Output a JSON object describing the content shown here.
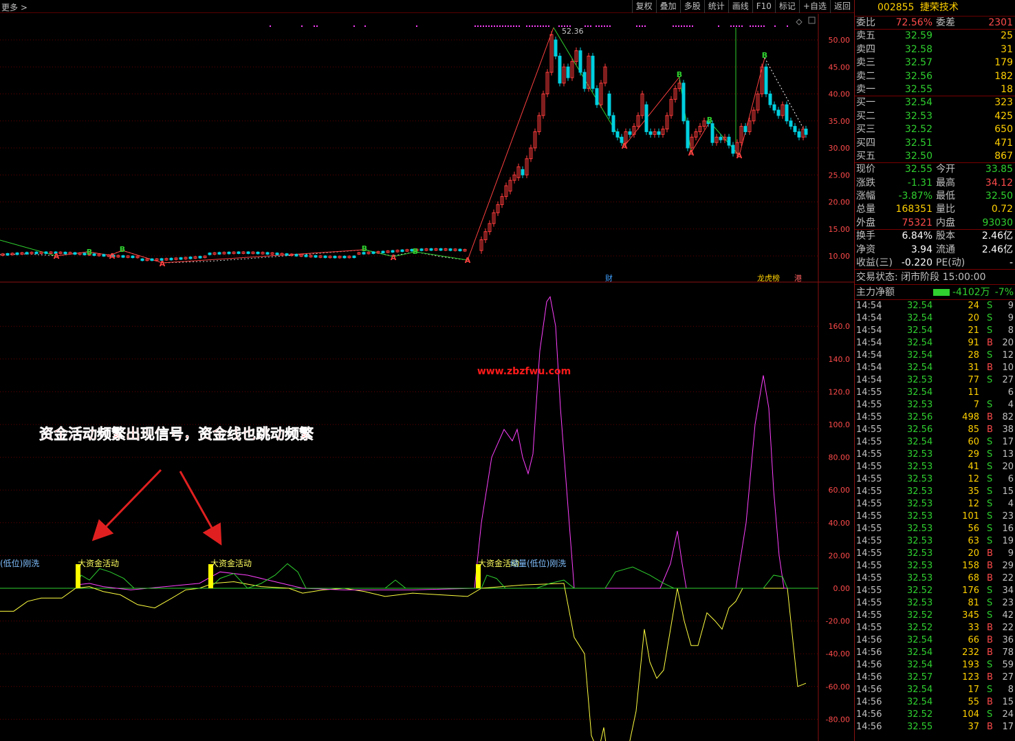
{
  "toolbar": {
    "more_label": "更多 >",
    "buttons": [
      "复权",
      "叠加",
      "多股",
      "统计",
      "画线",
      "F10",
      "标记",
      "+自选",
      "返回"
    ]
  },
  "chart": {
    "price_axis": [
      "50.00",
      "45.00",
      "40.00",
      "35.00",
      "30.00",
      "25.00",
      "20.00",
      "15.00",
      "10.00"
    ],
    "indicator_axis": [
      "160.0",
      "140.0",
      "120.0",
      "100.0",
      "80.00",
      "60.00",
      "40.00",
      "20.00",
      "0.00",
      "-20.00",
      "-40.00",
      "-60.00",
      "-80.00"
    ],
    "peak_label": "52.36",
    "marker_cai": "财",
    "marker_lhb": "龙虎榜",
    "marker_gang": "港",
    "watermark": "www.zbzfwu.com",
    "annotation": "资金活动频繁出现信号，资金线也跳动频繁",
    "signal_label_1": "大资金活动",
    "signal_label_2": "大资金活动",
    "signal_label_3": "大资金活动",
    "side_label_1": "量(低位)刚洗",
    "side_label_3": "缩量(低位)刚洗",
    "colors": {
      "up": "#ff3b3b",
      "down": "#00d0e0",
      "ma": "#ff4040",
      "green_line": "#2fd02f",
      "magenta": "#ff40ff",
      "yellow": "#ffff40",
      "grid": "#6a0000"
    }
  },
  "quote": {
    "code": "002855",
    "name": "捷荣技术",
    "weibi_label": "委比",
    "weibi": "72.56%",
    "weicha_label": "委差",
    "weicha": "2301",
    "asks": [
      {
        "label": "卖五",
        "price": "32.59",
        "vol": "25"
      },
      {
        "label": "卖四",
        "price": "32.58",
        "vol": "31"
      },
      {
        "label": "卖三",
        "price": "32.57",
        "vol": "179"
      },
      {
        "label": "卖二",
        "price": "32.56",
        "vol": "182"
      },
      {
        "label": "卖一",
        "price": "32.55",
        "vol": "18"
      }
    ],
    "bids": [
      {
        "label": "买一",
        "price": "32.54",
        "vol": "323"
      },
      {
        "label": "买二",
        "price": "32.53",
        "vol": "425"
      },
      {
        "label": "买三",
        "price": "32.52",
        "vol": "650"
      },
      {
        "label": "买四",
        "price": "32.51",
        "vol": "471"
      },
      {
        "label": "买五",
        "price": "32.50",
        "vol": "867"
      }
    ],
    "stats": [
      {
        "l1": "现价",
        "v1": "32.55",
        "l2": "今开",
        "v2": "33.85"
      },
      {
        "l1": "涨跌",
        "v1": "-1.31",
        "l2": "最高",
        "v2": "34.12"
      },
      {
        "l1": "涨幅",
        "v1": "-3.87%",
        "l2": "最低",
        "v2": "32.50"
      },
      {
        "l1": "总量",
        "v1": "168351",
        "l2": "量比",
        "v2": "0.72"
      },
      {
        "l1": "外盘",
        "v1": "75321",
        "l2": "内盘",
        "v2": "93030"
      }
    ],
    "stats2": [
      {
        "l1": "换手",
        "v1": "6.84%",
        "l2": "股本",
        "v2": "2.46亿"
      },
      {
        "l1": "净资",
        "v1": "3.94",
        "l2": "流通",
        "v2": "2.46亿"
      },
      {
        "l1": "收益(三)",
        "v1": "-0.220",
        "l2": "PE(动)",
        "v2": "-"
      }
    ],
    "status": "交易状态: 闭市阶段 15:00:00",
    "flow_label": "主力净额",
    "flow_amount": "-4102万",
    "flow_pct": "-7%"
  },
  "ticks": [
    {
      "t": "14:54",
      "p": "32.54",
      "v": "24",
      "bs": "S",
      "n": "9"
    },
    {
      "t": "14:54",
      "p": "32.54",
      "v": "20",
      "bs": "S",
      "n": "9"
    },
    {
      "t": "14:54",
      "p": "32.54",
      "v": "21",
      "bs": "S",
      "n": "8"
    },
    {
      "t": "14:54",
      "p": "32.54",
      "v": "91",
      "bs": "B",
      "n": "20"
    },
    {
      "t": "14:54",
      "p": "32.54",
      "v": "28",
      "bs": "S",
      "n": "12"
    },
    {
      "t": "14:54",
      "p": "32.54",
      "v": "31",
      "bs": "B",
      "n": "10"
    },
    {
      "t": "14:54",
      "p": "32.53",
      "v": "77",
      "bs": "S",
      "n": "27"
    },
    {
      "t": "14:55",
      "p": "32.54",
      "v": "11",
      "bs": "",
      "n": "6"
    },
    {
      "t": "14:55",
      "p": "32.53",
      "v": "7",
      "bs": "S",
      "n": "4"
    },
    {
      "t": "14:55",
      "p": "32.56",
      "v": "498",
      "bs": "B",
      "n": "82"
    },
    {
      "t": "14:55",
      "p": "32.56",
      "v": "85",
      "bs": "B",
      "n": "38"
    },
    {
      "t": "14:55",
      "p": "32.54",
      "v": "60",
      "bs": "S",
      "n": "17"
    },
    {
      "t": "14:55",
      "p": "32.53",
      "v": "29",
      "bs": "S",
      "n": "13"
    },
    {
      "t": "14:55",
      "p": "32.53",
      "v": "41",
      "bs": "S",
      "n": "20"
    },
    {
      "t": "14:55",
      "p": "32.53",
      "v": "12",
      "bs": "S",
      "n": "6"
    },
    {
      "t": "14:55",
      "p": "32.53",
      "v": "35",
      "bs": "S",
      "n": "15"
    },
    {
      "t": "14:55",
      "p": "32.53",
      "v": "12",
      "bs": "S",
      "n": "4"
    },
    {
      "t": "14:55",
      "p": "32.53",
      "v": "101",
      "bs": "S",
      "n": "23"
    },
    {
      "t": "14:55",
      "p": "32.53",
      "v": "56",
      "bs": "S",
      "n": "16"
    },
    {
      "t": "14:55",
      "p": "32.53",
      "v": "63",
      "bs": "S",
      "n": "19"
    },
    {
      "t": "14:55",
      "p": "32.53",
      "v": "20",
      "bs": "B",
      "n": "9"
    },
    {
      "t": "14:55",
      "p": "32.53",
      "v": "158",
      "bs": "B",
      "n": "29"
    },
    {
      "t": "14:55",
      "p": "32.53",
      "v": "68",
      "bs": "B",
      "n": "22"
    },
    {
      "t": "14:55",
      "p": "32.52",
      "v": "176",
      "bs": "S",
      "n": "34"
    },
    {
      "t": "14:55",
      "p": "32.53",
      "v": "81",
      "bs": "S",
      "n": "23"
    },
    {
      "t": "14:55",
      "p": "32.52",
      "v": "345",
      "bs": "S",
      "n": "42"
    },
    {
      "t": "14:55",
      "p": "32.52",
      "v": "33",
      "bs": "B",
      "n": "22"
    },
    {
      "t": "14:56",
      "p": "32.54",
      "v": "66",
      "bs": "B",
      "n": "36"
    },
    {
      "t": "14:56",
      "p": "32.54",
      "v": "232",
      "bs": "B",
      "n": "78"
    },
    {
      "t": "14:56",
      "p": "32.54",
      "v": "193",
      "bs": "S",
      "n": "59"
    },
    {
      "t": "14:56",
      "p": "32.57",
      "v": "123",
      "bs": "B",
      "n": "27"
    },
    {
      "t": "14:56",
      "p": "32.54",
      "v": "17",
      "bs": "S",
      "n": "8"
    },
    {
      "t": "14:56",
      "p": "32.54",
      "v": "55",
      "bs": "B",
      "n": "15"
    },
    {
      "t": "14:56",
      "p": "32.52",
      "v": "104",
      "bs": "S",
      "n": "24"
    },
    {
      "t": "14:56",
      "p": "32.55",
      "v": "37",
      "bs": "B",
      "n": "17"
    }
  ]
}
